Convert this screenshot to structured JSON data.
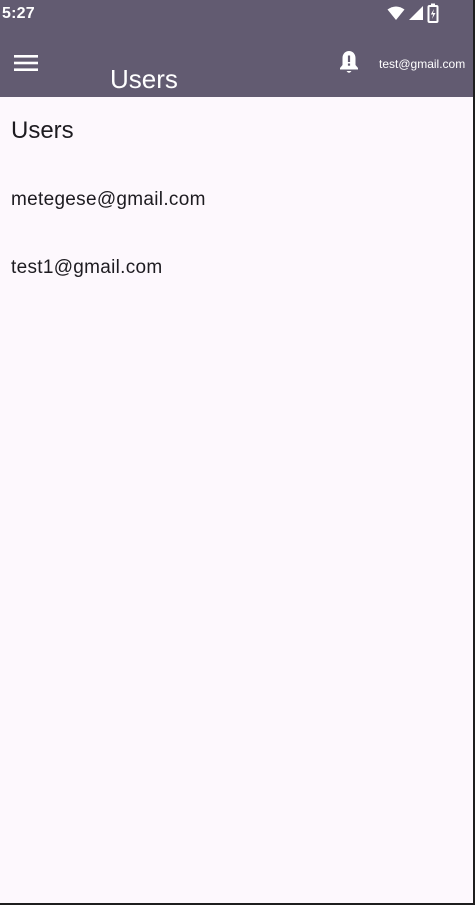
{
  "status_bar": {
    "time": "5:27",
    "icons": [
      "wifi-icon",
      "signal-icon",
      "battery-charging-icon"
    ]
  },
  "app_bar": {
    "title": "Users",
    "menu_icon": "menu-icon",
    "notification_icon": "bell-alert-icon",
    "account_email": "test@gmail.com",
    "background_color": "#625b71"
  },
  "main": {
    "heading": "Users",
    "users": [
      {
        "email": "metegese@gmail.com"
      },
      {
        "email": "test1@gmail.com"
      }
    ],
    "background_color": "#fdf8fd"
  }
}
